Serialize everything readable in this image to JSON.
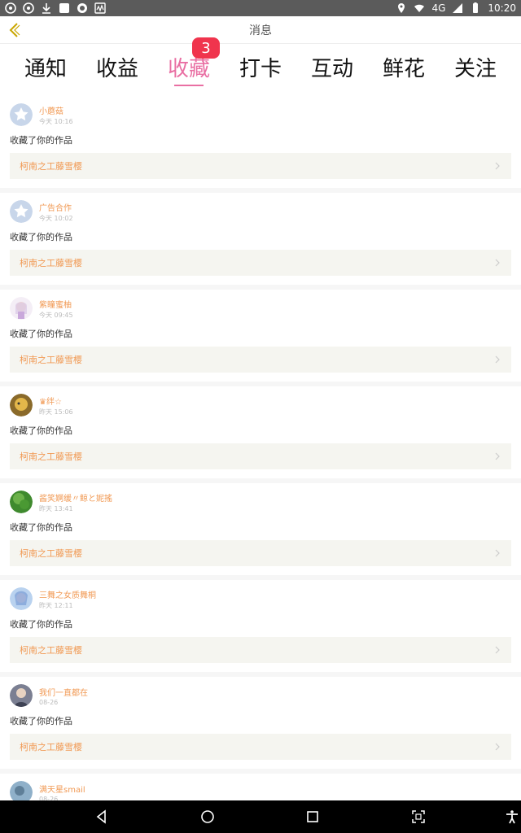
{
  "status_bar": {
    "left_icons": [
      "aperture-icon",
      "aperture-icon",
      "download-icon",
      "square-icon",
      "chat-icon",
      "waveform-icon"
    ],
    "right_icons": [
      "location-icon",
      "wifi-icon",
      "signal-icon",
      "battery-icon"
    ],
    "network": "4G",
    "time": "10:20"
  },
  "header": {
    "title": "消息",
    "back_icon": "chevron-left-icon"
  },
  "tabs": [
    {
      "label": "通知"
    },
    {
      "label": "收益"
    },
    {
      "label": "收藏",
      "active": true,
      "badge": "3"
    },
    {
      "label": "打卡"
    },
    {
      "label": "互动"
    },
    {
      "label": "鲜花"
    },
    {
      "label": "关注"
    }
  ],
  "items": [
    {
      "user": "小蘑菇",
      "time": "今天 10:16",
      "action": "收藏了你的作品",
      "work": "柯南之工藤雪樱",
      "avatar": "star-avatar"
    },
    {
      "user": "广告合作",
      "time": "今天 10:02",
      "action": "收藏了你的作品",
      "work": "柯南之工藤雪樱",
      "avatar": "star-avatar"
    },
    {
      "user": "紫瞳蜜柚",
      "time": "今天 09:45",
      "action": "收藏了你的作品",
      "work": "柯南之工藤雪樱",
      "avatar": "anime-avatar"
    },
    {
      "user": "♛绊☆",
      "time": "昨天 15:06",
      "action": "收藏了你的作品",
      "work": "柯南之工藤雪樱",
      "avatar": "photo-avatar-yellow"
    },
    {
      "user": "酱笑婀缓〃鲸と妮搖",
      "time": "昨天 13:41",
      "action": "收藏了你的作品",
      "work": "柯南之工藤雪樱",
      "avatar": "photo-avatar-green"
    },
    {
      "user": "三舞之女质舞桐",
      "time": "昨天 12:11",
      "action": "收藏了你的作品",
      "work": "柯南之工藤雪樱",
      "avatar": "anime-avatar-blue"
    },
    {
      "user": "我们一直都在",
      "time": "08-26",
      "action": "收藏了你的作品",
      "work": "柯南之工藤雪樱",
      "avatar": "photo-avatar-person"
    },
    {
      "user": "满天星smail",
      "time": "08-26",
      "action": "",
      "work": "",
      "avatar": "photo-avatar-sky"
    }
  ],
  "nav": [
    "back-icon",
    "home-icon",
    "recents-icon",
    "screenshot-icon",
    "accessibility-icon"
  ],
  "colors": {
    "accent": "#e96fa3",
    "badge": "#f0344d",
    "username": "#f19a55",
    "work_bg": "#f5f5f0"
  }
}
